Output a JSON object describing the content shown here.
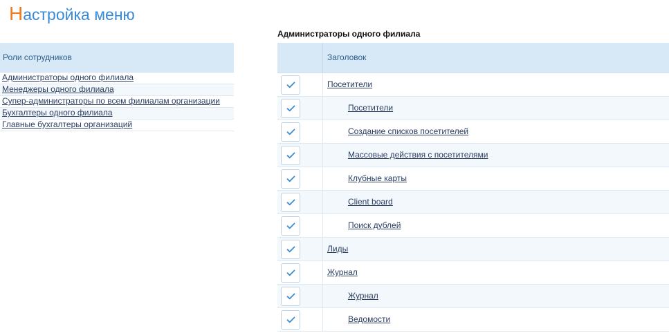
{
  "page": {
    "title_first": "Н",
    "title_rest": "астройка меню"
  },
  "roles": {
    "header": "Роли сотрудников",
    "items": [
      {
        "label": "Администраторы одного филиала"
      },
      {
        "label": "Менеджеры одного филиала"
      },
      {
        "label": "Супер-администраторы по всем филиалам организации"
      },
      {
        "label": "Бухгалтеры одного филиала"
      },
      {
        "label": "Главные бухгалтеры организаций"
      }
    ]
  },
  "menu": {
    "caption": "Администраторы одного филиала",
    "column_title": "Заголовок",
    "rows": [
      {
        "label": "Посетители",
        "level": 0,
        "checked": true
      },
      {
        "label": "Посетители",
        "level": 1,
        "checked": true
      },
      {
        "label": "Создание списков посетителей",
        "level": 1,
        "checked": true
      },
      {
        "label": "Массовые действия с посетителями",
        "level": 1,
        "checked": true
      },
      {
        "label": "Клубные карты",
        "level": 1,
        "checked": true
      },
      {
        "label": "Client board",
        "level": 1,
        "checked": true
      },
      {
        "label": "Поиск дублей",
        "level": 1,
        "checked": true
      },
      {
        "label": "Лиды",
        "level": 0,
        "checked": true
      },
      {
        "label": "Журнал",
        "level": 0,
        "checked": true
      },
      {
        "label": "Журнал",
        "level": 1,
        "checked": true
      },
      {
        "label": "Ведомости",
        "level": 1,
        "checked": true
      }
    ]
  },
  "colors": {
    "accent_blue": "#3a8ad6",
    "accent_orange": "#f07b1e",
    "header_bg": "#d7e9f7",
    "check_color": "#3a8ad6"
  },
  "icons": {
    "checkbox": "check-icon"
  }
}
